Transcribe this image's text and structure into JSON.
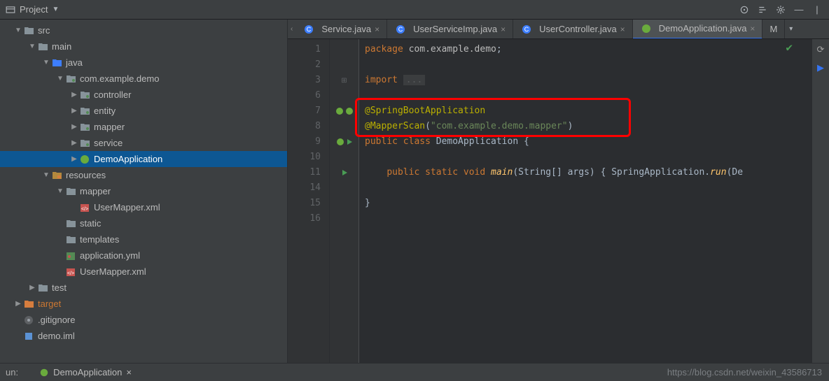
{
  "project": {
    "title": "Project",
    "tree": [
      {
        "indent": 0,
        "arrow": "down",
        "icon": "folder-gray",
        "label": "src"
      },
      {
        "indent": 1,
        "arrow": "down",
        "icon": "folder-gray",
        "label": "main"
      },
      {
        "indent": 2,
        "arrow": "down",
        "icon": "folder-blue",
        "label": "java"
      },
      {
        "indent": 3,
        "arrow": "down",
        "icon": "package",
        "label": "com.example.demo"
      },
      {
        "indent": 4,
        "arrow": "right",
        "icon": "package",
        "label": "controller"
      },
      {
        "indent": 4,
        "arrow": "right",
        "icon": "package",
        "label": "entity"
      },
      {
        "indent": 4,
        "arrow": "right",
        "icon": "package",
        "label": "mapper"
      },
      {
        "indent": 4,
        "arrow": "right",
        "icon": "package",
        "label": "service"
      },
      {
        "indent": 4,
        "arrow": "right",
        "icon": "spring",
        "label": "DemoApplication",
        "selected": true
      },
      {
        "indent": 2,
        "arrow": "down",
        "icon": "resources",
        "label": "resources"
      },
      {
        "indent": 3,
        "arrow": "down",
        "icon": "folder-gray",
        "label": "mapper"
      },
      {
        "indent": 4,
        "arrow": "none",
        "icon": "xml",
        "label": "UserMapper.xml"
      },
      {
        "indent": 3,
        "arrow": "none",
        "icon": "folder-gray",
        "label": "static"
      },
      {
        "indent": 3,
        "arrow": "none",
        "icon": "folder-gray",
        "label": "templates"
      },
      {
        "indent": 3,
        "arrow": "none",
        "icon": "yaml",
        "label": "application.yml"
      },
      {
        "indent": 3,
        "arrow": "none",
        "icon": "xml",
        "label": "UserMapper.xml"
      },
      {
        "indent": 1,
        "arrow": "right",
        "icon": "folder-gray",
        "label": "test"
      },
      {
        "indent": 0,
        "arrow": "right",
        "icon": "folder-orange",
        "label": "target"
      },
      {
        "indent": 0,
        "arrow": "none",
        "icon": "git",
        "label": ".gitignore"
      },
      {
        "indent": 0,
        "arrow": "none",
        "icon": "idea",
        "label": "demo.iml"
      }
    ]
  },
  "tabs": [
    {
      "icon": "java",
      "label": "Service.java",
      "partial": true
    },
    {
      "icon": "java",
      "label": "UserServiceImp.java"
    },
    {
      "icon": "java",
      "label": "UserController.java"
    },
    {
      "icon": "spring",
      "label": "DemoApplication.java",
      "active": true
    },
    {
      "icon": "none",
      "label": "M",
      "partial": true,
      "continuation": true
    }
  ],
  "code": {
    "lines": [
      1,
      2,
      3,
      6,
      7,
      8,
      9,
      10,
      11,
      14,
      15,
      16
    ],
    "line1": {
      "k1": "package ",
      "pkg": "com.example.demo",
      "semi": ";"
    },
    "line3": {
      "k1": "import ",
      "ellipsis": "..."
    },
    "line7": "@SpringBootApplication",
    "line8": {
      "a": "@MapperScan",
      "p1": "(",
      "s": "\"com.example.demo.mapper\"",
      "p2": ")"
    },
    "line9": {
      "k1": "public class ",
      "cls": "DemoApplication",
      "b": " {"
    },
    "line11": {
      "k1": "public static void ",
      "fn": "main",
      "args": "(String[] args) { SpringApplication.",
      "run": "run",
      "tail": "(De"
    },
    "line15": "}"
  },
  "status": {
    "run_label": "un:",
    "run_tab": "DemoApplication",
    "watermark": "https://blog.csdn.net/weixin_43586713"
  }
}
